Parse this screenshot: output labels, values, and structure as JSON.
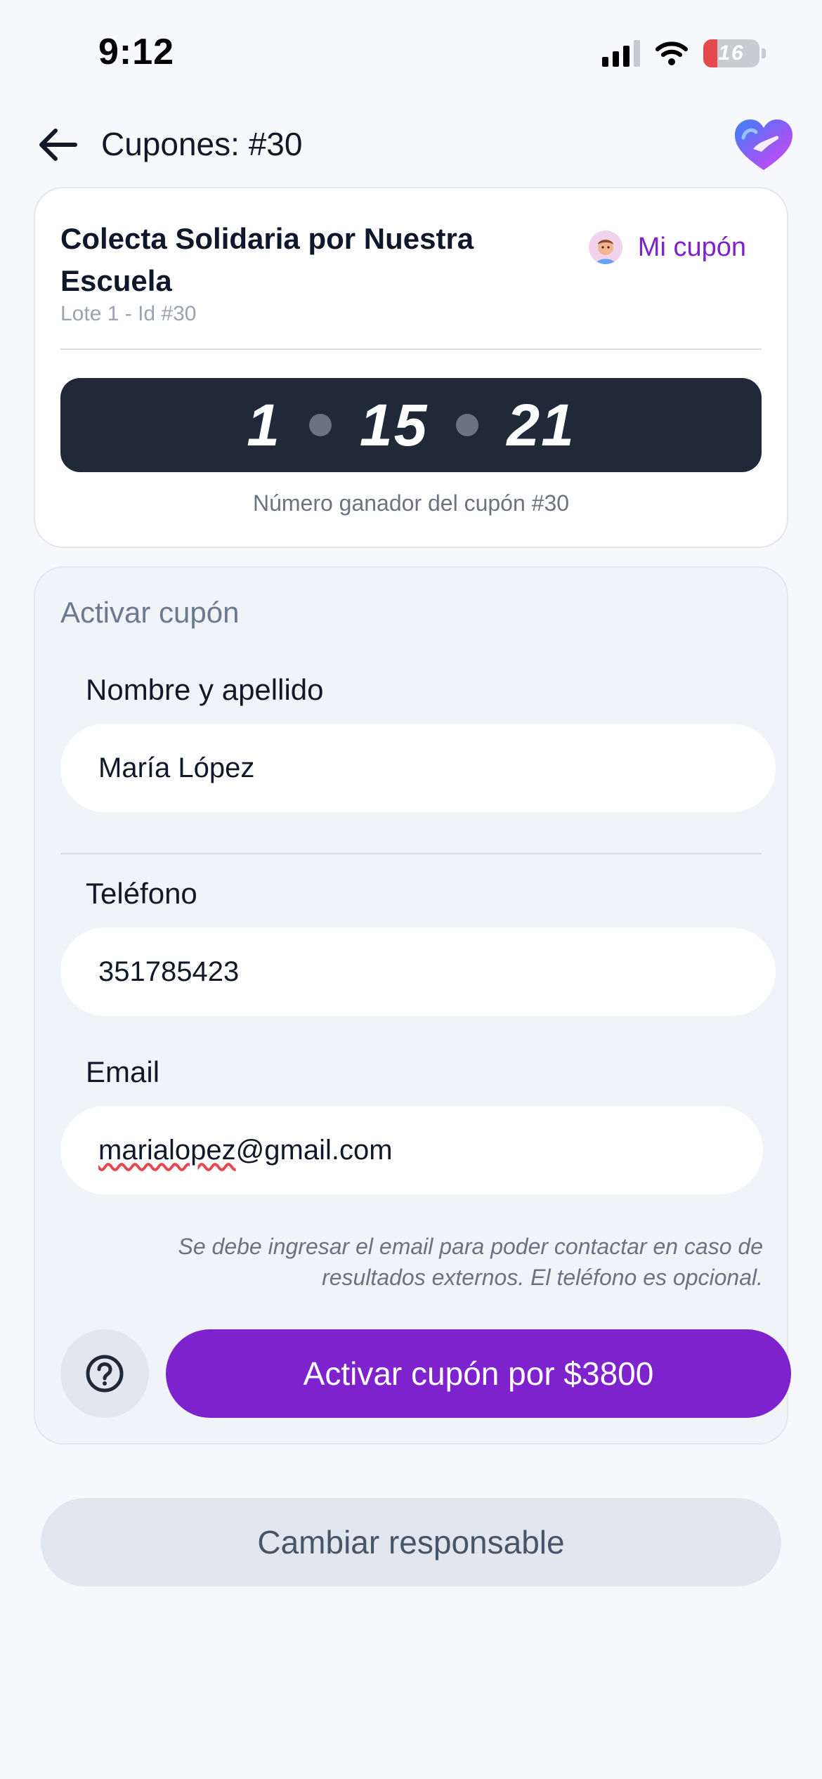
{
  "status_bar": {
    "time": "9:12",
    "battery": "16"
  },
  "header": {
    "title": "Cupones: #30"
  },
  "coupon": {
    "title": "Colecta Solidaria por Nuestra Escuela",
    "subtitle": "Lote 1 - Id #30",
    "mi_cupon_label": "Mi cupón",
    "numbers": [
      "1",
      "15",
      "21"
    ],
    "numbers_caption": "Número ganador del cupón #30"
  },
  "form": {
    "heading": "Activar cupón",
    "name_label": "Nombre y apellido",
    "name_value": "María López",
    "phone_label": "Teléfono",
    "phone_value": "351785423",
    "email_label": "Email",
    "email_value_misspelled": "marialopez",
    "email_value_rest": "@gmail.com",
    "help_text": "Se debe ingresar el email para poder contactar en caso de resultados externos. El teléfono es opcional.",
    "activate_label": "Activar cupón por $3800"
  },
  "footer": {
    "change_label": "Cambiar responsable"
  },
  "colors": {
    "accent": "#7e22ce",
    "dark_box": "#1f2937",
    "background": "#f7f8fb"
  },
  "icons": [
    "back-arrow-icon",
    "brand-heart-logo",
    "avatar-icon",
    "help-question-icon",
    "signal-icon",
    "wifi-icon",
    "battery-icon"
  ]
}
